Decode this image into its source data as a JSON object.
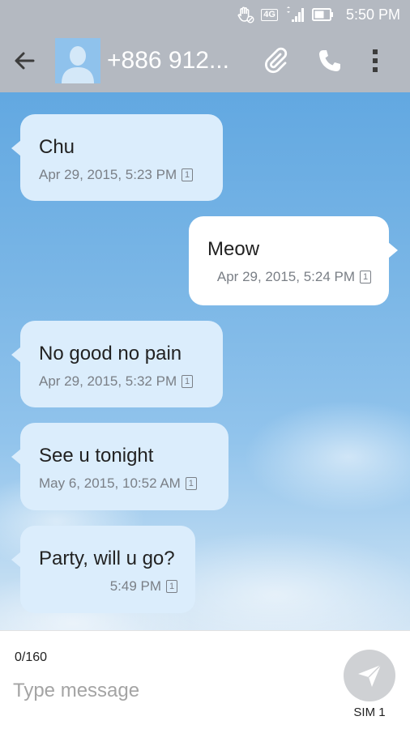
{
  "status_bar": {
    "network": "4G",
    "time": "5:50 PM",
    "icons": [
      "hand-mute-icon",
      "4g-icon",
      "signal-icon",
      "battery-icon"
    ]
  },
  "app_bar": {
    "contact": "+886 912...",
    "actions": [
      "back-arrow-icon",
      "attach-icon",
      "phone-icon",
      "more-vert-icon"
    ]
  },
  "messages": [
    {
      "direction": "incoming",
      "text": "Chu",
      "timestamp": "Apr 29, 2015, 5:23 PM",
      "sim": "1"
    },
    {
      "direction": "outgoing",
      "text": "Meow",
      "timestamp": "Apr 29, 2015, 5:24 PM",
      "sim": "1"
    },
    {
      "direction": "incoming",
      "text": "No good no pain",
      "timestamp": "Apr 29, 2015, 5:32 PM",
      "sim": "1"
    },
    {
      "direction": "incoming",
      "text": "See u tonight",
      "timestamp": "May 6, 2015, 10:52 AM",
      "sim": "1"
    },
    {
      "direction": "incoming",
      "text": "Party, will u go?",
      "timestamp": "5:49 PM",
      "sim": "1"
    }
  ],
  "compose": {
    "char_count": "0/160",
    "placeholder": "Type message",
    "send_sim_label": "SIM 1"
  },
  "colors": {
    "app_bar": "#b4b9c1",
    "incoming_bubble": "#dbedfc",
    "outgoing_bubble": "#ffffff",
    "send_button": "#cfd1d4"
  }
}
